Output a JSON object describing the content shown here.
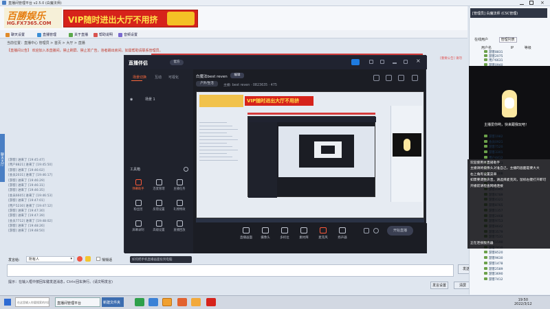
{
  "window": {
    "title": "直播间管理平台 v2.5.0 (白魔法师)"
  },
  "banner": {
    "logo_line1": "百勝娱乐",
    "logo_line2": "HG.FX7365.COM",
    "vip_slogan": "VIP随时进出大厅不用挤"
  },
  "top_tabs": [
    "聊天设置",
    "直播管理",
    "关于直播",
    "帮助说明",
    "音频设置"
  ],
  "address": "当前位置：直播中心 管理员 > 首页 > 大厅 > 直播",
  "announcement": "【直播间公告】 欢迎加入本直播间，禁止刷屏、禁止发广告，违者踢出房间。如需帮助请联系管理员。",
  "red_tag": "[重要公告] 请勿",
  "side_tab": "聊天大厅",
  "chat_lines": [
    "[游客] 进来了 [19:45:47]",
    "[用户8821] 进来了 [19:45:50]",
    "[游客] 进来了 [19:46:02]",
    "[会员2031] 进来了 [19:46:17]",
    "[游客] 进来了 [19:46:29]",
    "[游客] 进来了 [19:46:31]",
    "[游客] 进来了 [19:46:35]",
    "[会员6605] 进来了 [19:46:53]",
    "[游客] 进来了 [19:47:01]",
    "[用户5230] 进来了 [19:47:12]",
    "[游客] 进来了 [19:47:30]",
    "[游客] 进来了 [19:47:39]",
    "[会员7712] 进来了 [19:48:02]",
    "[游客] 进来了 [19:48:26]",
    "[游客] 进来了 [19:48:50]"
  ],
  "input": {
    "to_label": "发言给:",
    "to_value": "所有人",
    "private_label": "悄悄话",
    "send_label": "发送"
  },
  "tip": "提示：在输入框中按回车键发送消息，Ctrl+回车换行。(请文明发言)",
  "bottom_buttons": [
    "发言设置",
    "清屏"
  ],
  "right_panel": {
    "notification": "[管理员] 白魔法师 (CSC管理)",
    "tabs": [
      "在线用户",
      "管理列表"
    ],
    "header": [
      "用户名",
      "IP",
      "等级"
    ],
    "webcam_caption": "主播爱你哟，快来跟我玩吧！",
    "users_top": [
      "游客8831",
      "游客2075",
      "用户6631",
      "游客0940",
      "游客2211"
    ],
    "users_bottom": [
      "游客1982",
      "会员0921",
      "游客7520",
      "游客3301",
      "用户4412",
      "游客1023",
      "游客5566",
      "会员8008",
      "游客1133",
      "游客9090",
      "游客2345",
      "游客6789",
      "游客4321",
      "游客8765",
      "游客1357",
      "游客2468",
      "游客9753",
      "游客8642",
      "游客3579",
      "游客7531",
      "游客1590",
      "游客7410",
      "游客8520",
      "游客9630",
      "游客1478",
      "游客2589",
      "游客3690",
      "游客7412"
    ],
    "overlay": [
      "欢迎使用本直播助手",
      "主播请将摄像头对准自己，主播的画面是要大大",
      "右上角有设置菜单",
      "如需要调整声音，请选择麦克风，鼠标右键打开即可",
      "开播前请检查网络连接",
      "",
      "",
      "",
      "",
      "",
      "",
      "",
      "",
      "",
      "正在连接服务器"
    ]
  },
  "companion": {
    "app_name": "直播伴侣",
    "version_badge": "官方",
    "tabs": [
      "场景切换",
      "互动",
      "可视化"
    ],
    "scene_item": "场景 1",
    "tools_heading": "工具箱",
    "tools": [
      {
        "label": "弹幕助手",
        "icon": "danmaku-icon",
        "hot": true
      },
      {
        "label": "连麦管理",
        "icon": "mic-link-icon",
        "hot": false
      },
      {
        "label": "主播任务",
        "icon": "task-icon",
        "hot": false
      },
      {
        "label": "粉丝团",
        "icon": "fans-icon",
        "hot": false
      },
      {
        "label": "房管设置",
        "icon": "admin-icon",
        "hot": false
      },
      {
        "label": "礼物特效",
        "icon": "gift-icon",
        "hot": false
      },
      {
        "label": "屏幕录制",
        "icon": "record-icon",
        "hot": false
      },
      {
        "label": "高级设置",
        "icon": "advanced-icon",
        "hot": false
      },
      {
        "label": "直播回放",
        "icon": "replay-icon",
        "hot": false
      }
    ],
    "banner_text": "如何把手机直播画面投到电脑",
    "stream_title": "白魔法best reven",
    "edit_label": "编辑",
    "category": "户外/生活",
    "meta": "主播: best reven · 0823635 · 475",
    "controls": [
      "直播画面",
      "摄像头",
      "多机位",
      "素材库",
      "麦克风",
      "扬声器"
    ],
    "live_button": "开始直播"
  },
  "taskbar": {
    "search_placeholder": "在这里输入你要搜索的内容",
    "task1": "直播间管理平台",
    "task2": "新建文件夹",
    "time": "19:50",
    "date": "2022/3/12"
  },
  "colors": {
    "brand_red": "#d6231b",
    "accent_orange": "#ff6b3d",
    "dark_bg": "#1b1d24",
    "green_icon": "#6ba04a"
  }
}
